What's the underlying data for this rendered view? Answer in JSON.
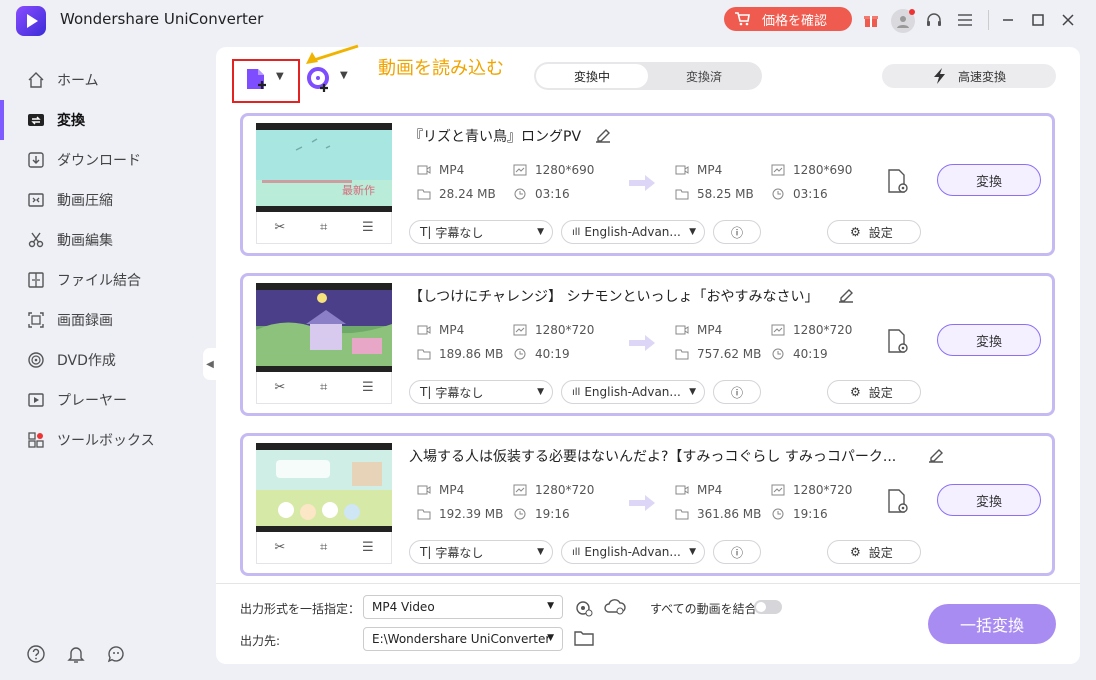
{
  "app": {
    "title": "Wondershare UniConverter",
    "buy_label": "価格を確認"
  },
  "sidebar": {
    "items": [
      {
        "label": "ホーム",
        "icon": "home-icon"
      },
      {
        "label": "変換",
        "icon": "convert-icon",
        "active": true
      },
      {
        "label": "ダウンロード",
        "icon": "download-icon"
      },
      {
        "label": "動画圧縮",
        "icon": "compress-icon"
      },
      {
        "label": "動画編集",
        "icon": "scissors-icon"
      },
      {
        "label": "ファイル結合",
        "icon": "merge-icon"
      },
      {
        "label": "画面録画",
        "icon": "record-icon"
      },
      {
        "label": "DVD作成",
        "icon": "dvd-icon"
      },
      {
        "label": "プレーヤー",
        "icon": "player-icon"
      },
      {
        "label": "ツールボックス",
        "icon": "toolbox-icon"
      }
    ]
  },
  "toolbar": {
    "annotation": "動画を読み込む",
    "tabs": [
      "変換中",
      "変換済"
    ],
    "fast_convert_label": "高速変換"
  },
  "files": [
    {
      "title": "『リズと青い鳥』ロングPV",
      "src_format": "MP4",
      "src_resolution": "1280*690",
      "src_size": "28.24 MB",
      "src_duration": "03:16",
      "dst_format": "MP4",
      "dst_resolution": "1280*690",
      "dst_size": "58.25 MB",
      "dst_duration": "03:16",
      "subtitle": "字幕なし",
      "audio": "English-Advan...",
      "settings_label": "設定",
      "convert_label": "変換"
    },
    {
      "title": "【しつけにチャレンジ】 シナモンといっしょ「おやすみなさい」",
      "src_format": "MP4",
      "src_resolution": "1280*720",
      "src_size": "189.86 MB",
      "src_duration": "40:19",
      "dst_format": "MP4",
      "dst_resolution": "1280*720",
      "dst_size": "757.62 MB",
      "dst_duration": "40:19",
      "subtitle": "字幕なし",
      "audio": "English-Advan...",
      "settings_label": "設定",
      "convert_label": "変換"
    },
    {
      "title": "入場する人は仮装する必要はないんだよ?【すみっコぐらし すみっコパーク...",
      "src_format": "MP4",
      "src_resolution": "1280*720",
      "src_size": "192.39 MB",
      "src_duration": "19:16",
      "dst_format": "MP4",
      "dst_resolution": "1280*720",
      "dst_size": "361.86 MB",
      "dst_duration": "19:16",
      "subtitle": "字幕なし",
      "audio": "English-Advan...",
      "settings_label": "設定",
      "convert_label": "変換"
    }
  ],
  "bottom": {
    "format_label": "出力形式を一括指定：",
    "format_value": "MP4 Video",
    "merge_label": "すべての動画を結合",
    "output_label": "出力先:",
    "output_path": "E:\\Wondershare UniConverter",
    "convert_all_label": "一括変換"
  },
  "colors": {
    "accent": "#7d5bff",
    "buy": "#ef5b4f",
    "highlight": "#e32222",
    "annotation": "#f0a400"
  }
}
